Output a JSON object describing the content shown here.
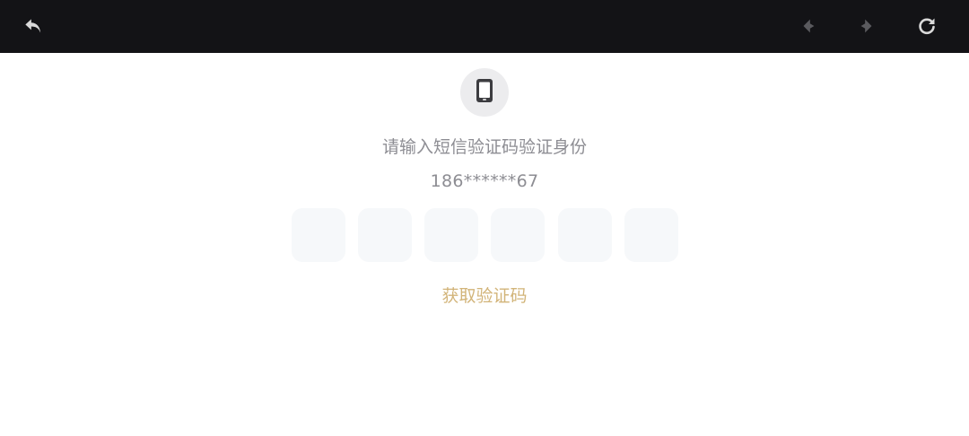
{
  "toolbar": {
    "back_icon": "undo-arrow-icon",
    "prev_icon": "chevron-left-icon",
    "next_icon": "chevron-right-icon",
    "refresh_icon": "refresh-icon",
    "bg_color": "#131316"
  },
  "verify": {
    "icon": "smartphone-icon",
    "prompt": "请输入短信验证码验证身份",
    "phone_masked": "186******67",
    "code_boxes": [
      "",
      "",
      "",
      "",
      "",
      ""
    ],
    "get_code_label": "获取验证码",
    "accent_color": "#d2b479"
  }
}
